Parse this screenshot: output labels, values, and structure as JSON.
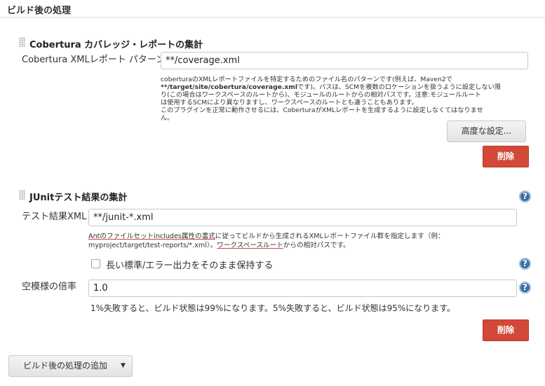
{
  "section": {
    "title": "ビルド後の処理"
  },
  "cobertura": {
    "title": "Cobertura カバレッジ・レポートの集計",
    "pattern_label": "Cobertura XMLレポート パターン",
    "pattern_value": "**/coverage.xml",
    "help_line1": "coberturaのXMLレポートファイルを特定するためのファイル名のパターンです(例えば、Maven2で",
    "help_line2_bold": "**/target/site/cobertura/coverage.xml",
    "help_line2_rest": "です)。パスは、SCMを複数のロケーションを扱うように設定しない限",
    "help_line3": "り(この場合はワークスペースのルートから)、モジュールのルートからの相対パスです。注意:モジュールルート",
    "help_line4": "は使用するSCMにより異なりますし、ワークスペースのルートとも違うこともあります。",
    "help_line5": "このプラグインを正常に動作させるには、CoberturaがXMLレポートを生成するように設定しなくてはなりませ",
    "help_line6": "ん。",
    "advanced_button": "高度な設定...",
    "delete_button": "削除"
  },
  "junit": {
    "title": "JUnitテスト結果の集計",
    "xml_label": "テスト結果XML",
    "xml_value": "**/junit-*.xml",
    "help_link1": "Antのファイルセットincludes属性の書式",
    "help_text1": "に従ってビルドから生成されるXMLレポートファイル群を指定します（例：",
    "help_text2": "myproject/target/test-reports/*.xml）。",
    "help_link2": "ワークスペースルート",
    "help_text3": "からの相対パスです。",
    "keep_output_label": "長い標準/エラー出力をそのまま保持する",
    "keep_output_checked": false,
    "health_label": "空模様の倍率",
    "health_value": "1.0",
    "health_info": "1%失敗すると、ビルド状態は99%になります。5%失敗すると、ビルド状態は95%になります。",
    "delete_button": "削除"
  },
  "add_postbuild": {
    "label": "ビルド後の処理の追加"
  },
  "icons": {
    "help": "?",
    "dropdown": "▼"
  },
  "colors": {
    "delete": "#d24939",
    "help": "#3b6ea5"
  }
}
